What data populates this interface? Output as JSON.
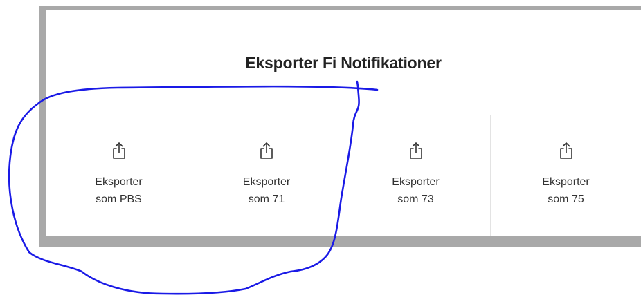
{
  "dialog": {
    "title": "Eksporter Fi Notifikationer"
  },
  "options": [
    {
      "line1": "Eksporter",
      "line2": "som PBS",
      "icon": "share-export-icon"
    },
    {
      "line1": "Eksporter",
      "line2": "som 71",
      "icon": "share-export-icon"
    },
    {
      "line1": "Eksporter",
      "line2": "som 73",
      "icon": "share-export-icon"
    },
    {
      "line1": "Eksporter",
      "line2": "som 75",
      "icon": "share-export-icon"
    }
  ],
  "colors": {
    "frame": "#a9a9a9",
    "title_text": "#222222",
    "label_text": "#333333",
    "annotation_stroke": "#1a1ae6"
  }
}
